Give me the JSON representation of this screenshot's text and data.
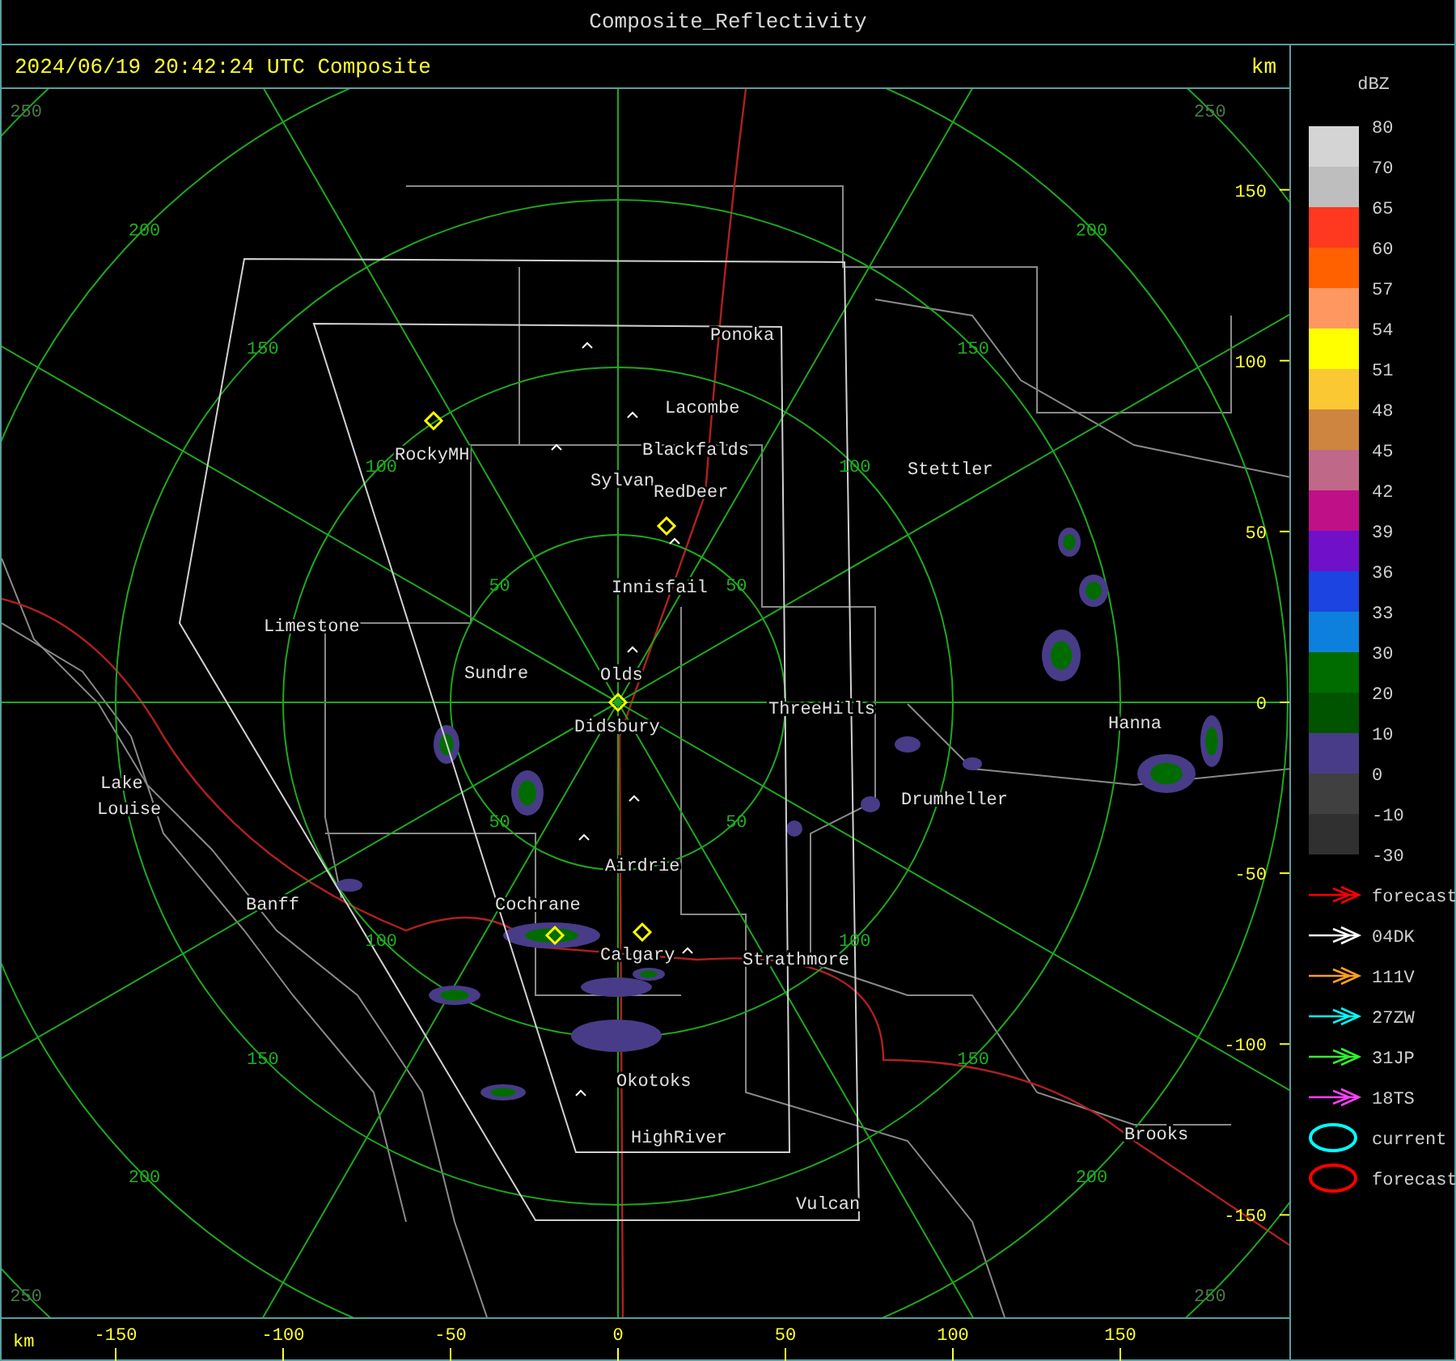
{
  "window": {
    "title": "Composite_Reflectivity"
  },
  "header": {
    "timestamp": "2024/06/19 20:42:24 UTC Composite",
    "unit": "km"
  },
  "map": {
    "cities": [
      {
        "name": "Ponoka"
      },
      {
        "name": "Lacombe"
      },
      {
        "name": "Blackfalds"
      },
      {
        "name": "Sylvan"
      },
      {
        "name": "RedDeer"
      },
      {
        "name": "Stettler"
      },
      {
        "name": "RockyMH"
      },
      {
        "name": "Innisfail"
      },
      {
        "name": "Limestone"
      },
      {
        "name": "Sundre"
      },
      {
        "name": "Olds"
      },
      {
        "name": "Didsbury"
      },
      {
        "name": "ThreeHills"
      },
      {
        "name": "Hanna"
      },
      {
        "name": "Lake"
      },
      {
        "name": "Louise"
      },
      {
        "name": "Drumheller"
      },
      {
        "name": "Airdrie"
      },
      {
        "name": "Banff"
      },
      {
        "name": "Cochrane"
      },
      {
        "name": "Calgary"
      },
      {
        "name": "Strathmore"
      },
      {
        "name": "Okotoks"
      },
      {
        "name": "Brooks"
      },
      {
        "name": "HighRiver"
      },
      {
        "name": "Vulcan"
      }
    ],
    "range_rings": [
      {
        "labels": [
          "50",
          "50",
          "50",
          "50"
        ]
      },
      {
        "labels": [
          "100",
          "100",
          "100",
          "100"
        ]
      },
      {
        "labels": [
          "150",
          "150",
          "150",
          "150"
        ]
      },
      {
        "labels": [
          "200",
          "200",
          "200",
          "200"
        ]
      },
      {
        "labels": [
          "250",
          "250",
          "250",
          "250"
        ]
      }
    ],
    "y_axis": [
      "150",
      "100",
      "50",
      "0",
      "-50",
      "-100",
      "-150"
    ]
  },
  "x_axis": {
    "unit": "km",
    "ticks": [
      "-150",
      "-100",
      "-50",
      "0",
      "50",
      "100",
      "150"
    ]
  },
  "legend": {
    "title": "dBZ",
    "labels": [
      "80",
      "70",
      "65",
      "60",
      "57",
      "54",
      "51",
      "48",
      "45",
      "42",
      "39",
      "36",
      "33",
      "30",
      "20",
      "10",
      "0",
      "-10",
      "-30"
    ],
    "bins": [
      {
        "color": "#d4d4d4"
      },
      {
        "color": "#bebebe"
      },
      {
        "color": "#ff3820"
      },
      {
        "color": "#ff6000"
      },
      {
        "color": "#ff9860"
      },
      {
        "color": "#ffff00"
      },
      {
        "color": "#fac832"
      },
      {
        "color": "#cd8540"
      },
      {
        "color": "#c06888"
      },
      {
        "color": "#c01088"
      },
      {
        "color": "#7010c8"
      },
      {
        "color": "#1c44e0"
      },
      {
        "color": "#0c80dc"
      },
      {
        "color": "#006c00"
      },
      {
        "color": "#005400"
      },
      {
        "color": "#483c88"
      },
      {
        "color": "#404040"
      },
      {
        "color": "#303030"
      }
    ],
    "tracks": [
      {
        "kind": "arrow",
        "label": "forecast",
        "color": "#ff0000"
      },
      {
        "kind": "arrow",
        "label": "04DK",
        "color": "#ffffff"
      },
      {
        "kind": "arrow",
        "label": "111V",
        "color": "#ffa020"
      },
      {
        "kind": "arrow",
        "label": "27ZW",
        "color": "#00ffff"
      },
      {
        "kind": "arrow",
        "label": "31JP",
        "color": "#30f030"
      },
      {
        "kind": "arrow",
        "label": "18TS",
        "color": "#ff40ff"
      },
      {
        "kind": "ellipse",
        "label": "current",
        "color": "#00ffff"
      },
      {
        "kind": "ellipse",
        "label": "forecast",
        "color": "#ff0000"
      }
    ]
  }
}
